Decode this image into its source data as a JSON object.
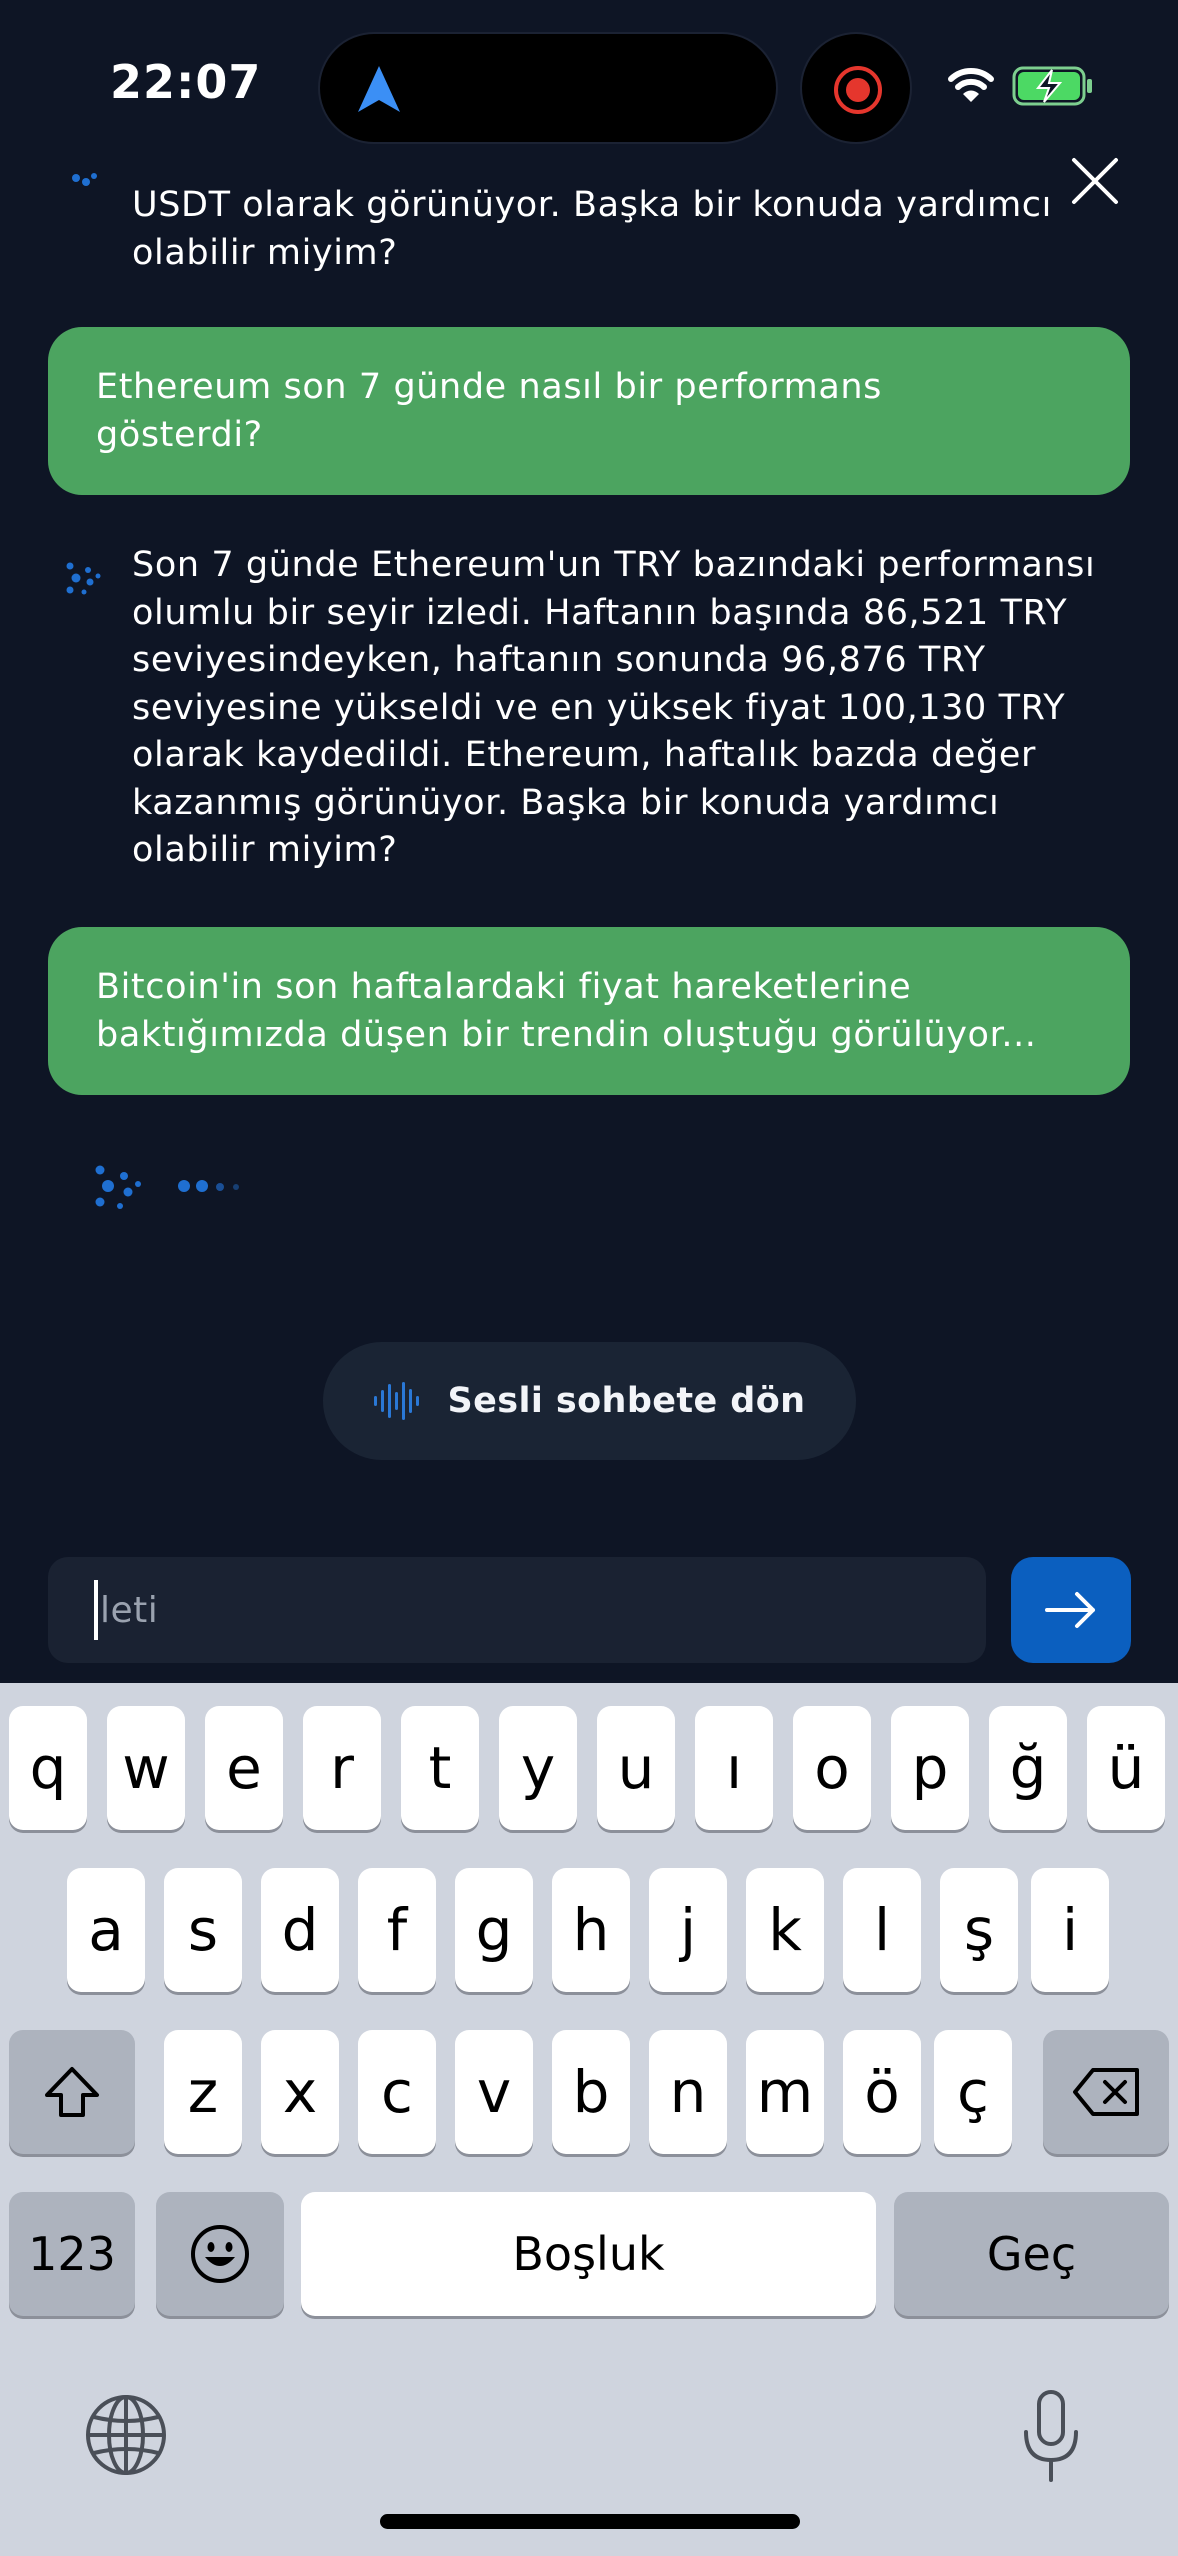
{
  "status_bar": {
    "time": "22:07"
  },
  "icons": {
    "navigation": "location-arrow-icon",
    "record": "screen-record-icon",
    "wifi": "wifi-icon",
    "battery": "battery-charging-icon",
    "close": "close-icon",
    "assistant": "assistant-logo-icon",
    "voice": "audio-wave-icon",
    "send": "arrow-right-icon",
    "shift": "shift-icon",
    "backspace": "backspace-icon",
    "emoji": "emoji-icon",
    "globe": "globe-icon",
    "mic": "microphone-icon"
  },
  "colors": {
    "background": "#0e1525",
    "user_bubble": "#4ca460",
    "accent_blue": "#0b5fbf",
    "battery_green": "#4cd964"
  },
  "messages": [
    {
      "role": "assistant",
      "text": "USDT olarak görünüyor. Başka bir konuda yardımcı\nolabilir miyim?"
    },
    {
      "role": "user",
      "text": "Ethereum son 7 günde nasıl bir performans\ngösterdi?"
    },
    {
      "role": "assistant",
      "text": "Son 7 günde Ethereum'un TRY bazındaki performansı\nolumlu bir seyir izledi. Haftanın başında 86,521 TRY\nseviyesindeyken, haftanın sonunda 96,876 TRY\nseviyesine yükseldi ve en yüksek fiyat 100,130 TRY\nolarak kaydedildi. Ethereum, haftalık bazda değer\nkazanmış görünüyor. Başka bir konuda yardımcı\nolabilir miyim?"
    },
    {
      "role": "user",
      "text": "Bitcoin'in son haftalardaki fiyat hareketlerine\nbaktığımızda düşen bir trendin oluştuğu görülüyor..."
    }
  ],
  "voice_chat": {
    "label": "Sesli sohbete dön"
  },
  "composer": {
    "placeholder": "İleti",
    "placeholder_visible": "leti"
  },
  "keyboard": {
    "row1": [
      "q",
      "w",
      "e",
      "r",
      "t",
      "y",
      "u",
      "ı",
      "o",
      "p",
      "ğ",
      "ü"
    ],
    "row2": [
      "a",
      "s",
      "d",
      "f",
      "g",
      "h",
      "j",
      "k",
      "l",
      "ş",
      "i"
    ],
    "row3": [
      "z",
      "x",
      "c",
      "v",
      "b",
      "n",
      "m",
      "ö",
      "ç"
    ],
    "numbers_label": "123",
    "space_label": "Boşluk",
    "return_label": "Geç"
  }
}
